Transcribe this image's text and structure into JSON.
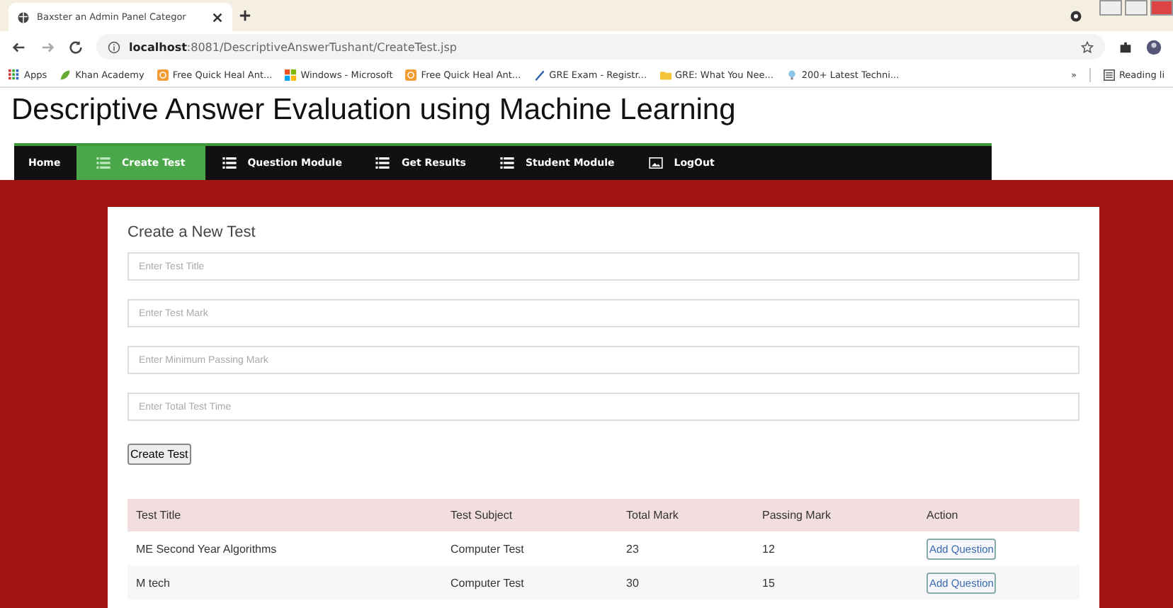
{
  "browser": {
    "tab_title": "Baxster an Admin Panel Categor",
    "url_host": "localhost",
    "url_path": ":8081/DescriptiveAnswerTushant/CreateTest.jsp",
    "bookmarks": [
      {
        "label": "Apps",
        "kind": "grid"
      },
      {
        "label": "Khan Academy",
        "kind": "leaf"
      },
      {
        "label": "Free Quick Heal Ant...",
        "kind": "shield"
      },
      {
        "label": "Windows - Microsoft",
        "kind": "windows"
      },
      {
        "label": "Free Quick Heal Ant...",
        "kind": "shield"
      },
      {
        "label": "GRE Exam - Registr...",
        "kind": "pen"
      },
      {
        "label": "GRE: What You Nee...",
        "kind": "folder"
      },
      {
        "label": "200+ Latest Techni...",
        "kind": "bulb"
      }
    ],
    "more": "»",
    "reading_list": "Reading li"
  },
  "page_title": "Descriptive Answer Evaluation using Machine Learning",
  "nav": [
    {
      "label": "Home",
      "kind": "plain",
      "selected": false
    },
    {
      "label": "Create Test",
      "kind": "list",
      "selected": true
    },
    {
      "label": "Question Module",
      "kind": "list",
      "selected": false
    },
    {
      "label": "Get Results",
      "kind": "list",
      "selected": false
    },
    {
      "label": "Student Module",
      "kind": "list",
      "selected": false
    },
    {
      "label": "LogOut",
      "kind": "image",
      "selected": false
    }
  ],
  "form": {
    "heading": "Create a New Test",
    "fields": [
      {
        "placeholder": "Enter Test Title"
      },
      {
        "placeholder": "Enter Test Mark"
      },
      {
        "placeholder": "Enter Minimum Passing Mark"
      },
      {
        "placeholder": "Enter Total Test Time"
      }
    ],
    "submit": "Create Test"
  },
  "table": {
    "columns": [
      "Test Title",
      "Test Subject",
      "Total Mark",
      "Passing Mark",
      "Action"
    ],
    "rows": [
      {
        "cells": [
          "ME Second Year Algorithms",
          "Computer Test",
          "23",
          "12"
        ],
        "action": "Add Question"
      },
      {
        "cells": [
          "M tech",
          "Computer Test",
          "30",
          "15"
        ],
        "action": "Add Question"
      }
    ]
  }
}
